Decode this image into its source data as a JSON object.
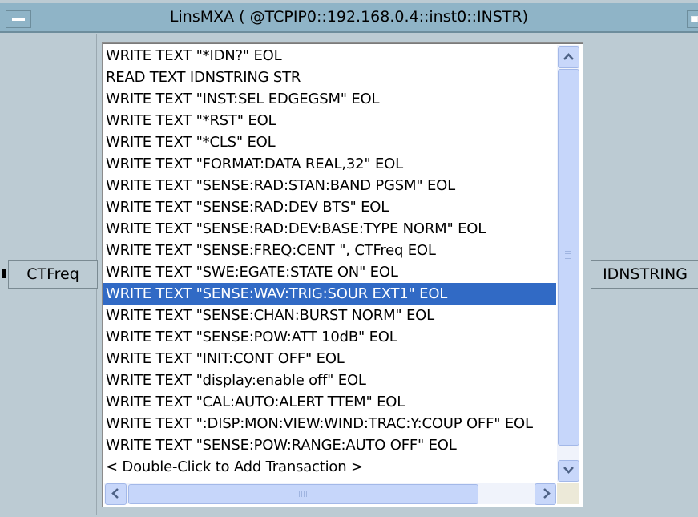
{
  "window": {
    "title": "LinsMXA ( @TCPIP0::192.168.0.4::inst0::INSTR)"
  },
  "pins": {
    "input_label": "CTFreq",
    "output_label": "IDNSTRING"
  },
  "transactions": [
    "WRITE TEXT \"*IDN?\" EOL",
    "READ TEXT IDNSTRING STR",
    "WRITE TEXT \"INST:SEL EDGEGSM\" EOL",
    "WRITE TEXT \"*RST\" EOL",
    "WRITE TEXT \"*CLS\" EOL",
    "WRITE TEXT \"FORMAT:DATA REAL,32\" EOL",
    "WRITE TEXT \"SENSE:RAD:STAN:BAND PGSM\" EOL",
    "WRITE TEXT \"SENSE:RAD:DEV BTS\" EOL",
    "WRITE TEXT \"SENSE:RAD:DEV:BASE:TYPE NORM\" EOL",
    "WRITE TEXT \"SENSE:FREQ:CENT \", CTFreq EOL",
    "WRITE TEXT \"SWE:EGATE:STATE ON\" EOL",
    "WRITE TEXT \"SENSE:WAV:TRIG:SOUR EXT1\" EOL",
    "WRITE TEXT \"SENSE:CHAN:BURST NORM\" EOL",
    "WRITE TEXT \"SENSE:POW:ATT 10dB\" EOL",
    "WRITE TEXT \"INIT:CONT OFF\" EOL",
    "WRITE TEXT \"display:enable off\" EOL",
    "WRITE TEXT \"CAL:AUTO:ALERT TTEM\" EOL",
    "WRITE  TEXT \":DISP:MON:VIEW:WIND:TRAC:Y:COUP  OFF\" EOL",
    "WRITE TEXT \"SENSE:POW:RANGE:AUTO OFF\" EOL",
    "< Double-Click to Add Transaction >"
  ],
  "selected_index": 11,
  "colors": {
    "selection": "#316ac5",
    "titlebar": "#8fb4c7",
    "panel": "#bccbd3"
  }
}
